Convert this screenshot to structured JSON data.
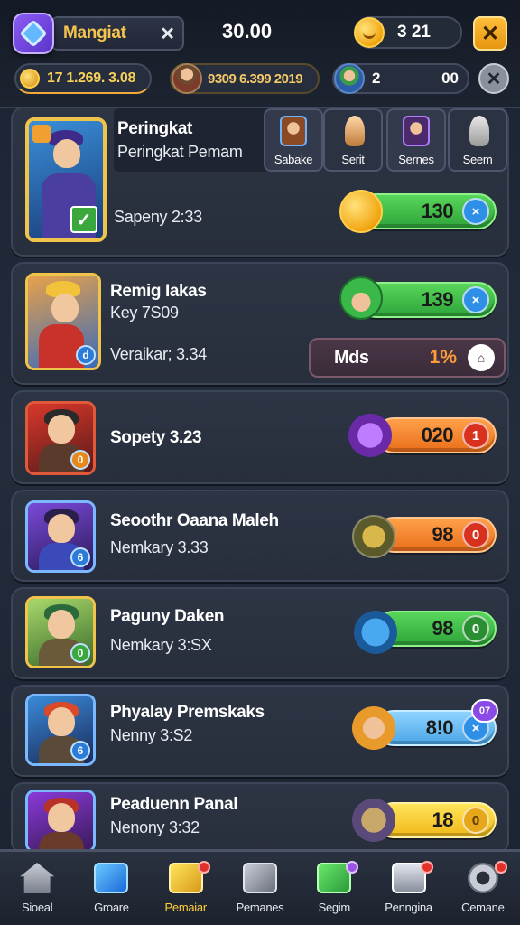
{
  "header": {
    "search_label": "Mangiat",
    "close_symbol": "✕",
    "balance": "30.00",
    "coins": "3 21",
    "stats": {
      "gold": "17 1.269. 3.08",
      "hero_stat": "9309 6.399 2019",
      "level": "2",
      "level_right": "00"
    }
  },
  "featured": {
    "title": "Peringkat",
    "subtitle": "Peringkat Pemam",
    "time": "Sapeny 2:33",
    "score": "130",
    "tabs": [
      {
        "label": "Sabake"
      },
      {
        "label": "Serit"
      },
      {
        "label": "Sernes"
      },
      {
        "label": "Seem"
      }
    ]
  },
  "second": {
    "name": "Remig Iakas",
    "key": "Key 7S09",
    "time": "Veraikar; 3.34",
    "score": "139",
    "mods_label": "Mds",
    "mods_pct": "1%"
  },
  "rows": [
    {
      "name": "Sopety 3.23",
      "sub": "",
      "score": "020"
    },
    {
      "name": "Seoothr Oaana Maleh",
      "sub": "Nemkary 3.33",
      "score": "98"
    },
    {
      "name": "Paguny Daken",
      "sub": "Nemkary 3:SX",
      "score": "98"
    },
    {
      "name": "Phyalay Premskaks",
      "sub": "Nenny 3:S2",
      "score": "8!0",
      "badge": "07"
    },
    {
      "name": "Peaduenn Panal",
      "sub": "Nenony 3:32",
      "score": "18"
    }
  ],
  "nav": [
    {
      "label": "Sioeal"
    },
    {
      "label": "Groare"
    },
    {
      "label": "Pemaiar"
    },
    {
      "label": "Pemanes"
    },
    {
      "label": "Segim"
    },
    {
      "label": "Penngina"
    },
    {
      "label": "Cemane"
    }
  ],
  "icons": {
    "row_badges": [
      "d",
      "0",
      "6",
      "0",
      "6"
    ],
    "pill_icons": [
      "×",
      "×",
      "1",
      "0",
      "0",
      "×",
      "0"
    ]
  }
}
